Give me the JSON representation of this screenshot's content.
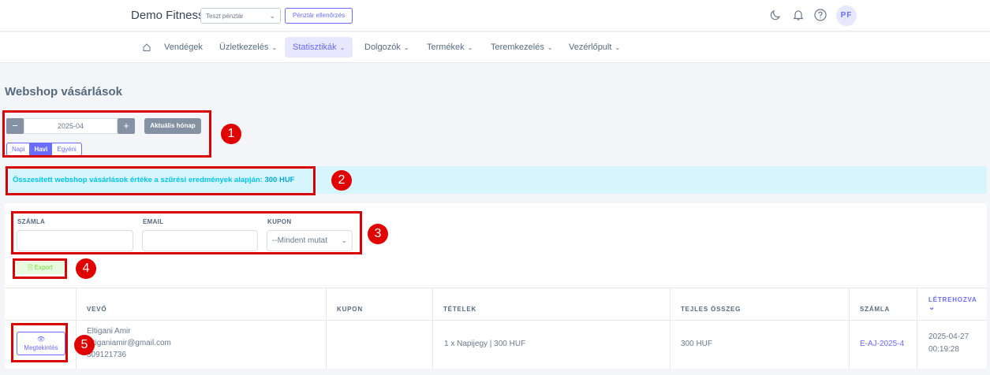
{
  "header": {
    "brand": "Demo Fitness",
    "cash_register_select": "Teszt pénztár",
    "cash_check_button": "Pénztár ellenőrzés",
    "avatar_initials": "PF"
  },
  "nav": {
    "items": [
      {
        "label": "Vendégek"
      },
      {
        "label": "Üzletkezelés"
      },
      {
        "label": "Statisztikák"
      },
      {
        "label": "Dolgozók"
      },
      {
        "label": "Termékek"
      },
      {
        "label": "Teremkezelés"
      },
      {
        "label": "Vezérlőpult"
      }
    ]
  },
  "page": {
    "title": "Webshop vásárlások"
  },
  "month_picker": {
    "minus": "−",
    "value": "2025-04",
    "plus": "+",
    "current_month_button": "Aktuális hónap",
    "modes": [
      "Napi",
      "Havi",
      "Egyéni"
    ],
    "active_mode": "Havi"
  },
  "summary": {
    "text": "Összesített webshop vásárlások értéke a szűrési eredmények alapján:",
    "amount": "300 HUF"
  },
  "filters": {
    "invoice_label": "SZÁMLA",
    "email_label": "EMAIL",
    "coupon_label": "KUPON",
    "coupon_value": "--Mindent mutat",
    "export_label": "Export"
  },
  "table": {
    "headers": {
      "buyer": "VEVŐ",
      "coupon": "KUPON",
      "items": "TÉTELEK",
      "total": "TEJLES ÖSSZEG",
      "invoice": "SZÁMLA",
      "created": "LÉTREHOZVA"
    },
    "rows": [
      {
        "view_button": "Megtekintés",
        "buyer_name": "Eltigani Amir",
        "buyer_email": "eltiganiamir@gmail.com",
        "buyer_phone": "309121736",
        "coupon": "",
        "items": "1 x Napijegy | 300 HUF",
        "total": "300 HUF",
        "invoice": "E-AJ-2025-4",
        "created_date": "2025-04-27",
        "created_time": "00:19:28"
      }
    ]
  },
  "annotations": [
    "1",
    "2",
    "3",
    "4",
    "5"
  ],
  "colors": {
    "accent": "#696cff",
    "info_bg": "#d7f5fc",
    "info_text": "#03c3ec",
    "annotation_red": "#d90000",
    "export_green": "#71dd37"
  }
}
